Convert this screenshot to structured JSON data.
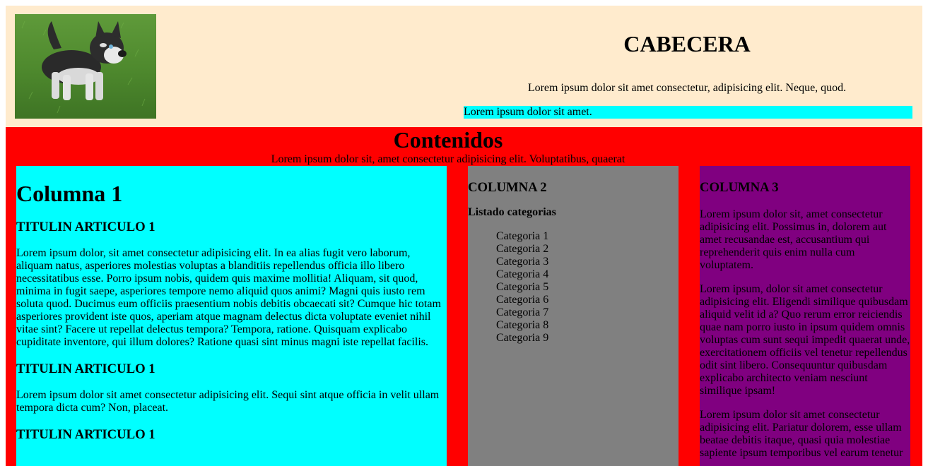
{
  "header": {
    "title": "CABECERA",
    "subtitle": "Lorem ipsum dolor sit amet consectetur, adipisicing elit. Neque, quod.",
    "bar_text": "Lorem ipsum dolor sit amet.",
    "image": "husky-puppy-photo",
    "colors": {
      "background": "#ffebcd",
      "bar": "#00ffff"
    }
  },
  "content": {
    "title": "Contenidos",
    "subtitle": "Lorem ipsum dolor sit, amet consectetur adipisicing elit. Voluptatibus, quaerat",
    "colors": {
      "background": "#ff0000"
    },
    "col1": {
      "color": "#00ffff",
      "heading": "Columna 1",
      "articles": [
        {
          "title": "TITULIN ARTICULO 1",
          "text": "Lorem ipsum dolor, sit amet consectetur adipisicing elit. In ea alias fugit vero laborum, aliquam natus, asperiores molestias voluptas a blanditiis repellendus officia illo libero necessitatibus esse. Porro ipsum nobis, quidem quis maxime mollitia! Aliquam, sit quod, minima in fugit saepe, asperiores tempore nemo aliquid quos animi? Magni quis iusto rem soluta quod. Ducimus eum officiis praesentium nobis debitis obcaecati sit? Cumque hic totam asperiores provident iste quos, aperiam atque magnam delectus dicta voluptate eveniet nihil vitae sint? Facere ut repellat delectus tempora? Tempora, ratione. Quisquam explicabo cupiditate inventore, qui illum dolores? Ratione quasi sint minus magni iste repellat facilis."
        },
        {
          "title": "TITULIN ARTICULO 1",
          "text": "Lorem ipsum dolor sit amet consectetur adipisicing elit. Sequi sint atque officia in velit ullam tempora dicta cum? Non, placeat."
        },
        {
          "title": "TITULIN ARTICULO 1"
        }
      ]
    },
    "col2": {
      "color": "#808080",
      "heading": "COLUMNA 2",
      "subheading": "Listado categorias",
      "items": [
        "Categoria 1",
        "Categoria 2",
        "Categoria 3",
        "Categoria 4",
        "Categoria 5",
        "Categoria 6",
        "Categoria 7",
        "Categoria 8",
        "Categoria 9"
      ]
    },
    "col3": {
      "color": "#800080",
      "heading": "COLUMNA 3",
      "paragraphs": [
        "Lorem ipsum dolor sit, amet consectetur adipisicing elit. Possimus in, dolorem aut amet recusandae est, accusantium qui reprehenderit quis enim nulla cum voluptatem.",
        "Lorem ipsum, dolor sit amet consectetur adipisicing elit. Eligendi similique quibusdam aliquid velit id a? Quo rerum error reiciendis quae nam porro iusto in ipsum quidem omnis voluptas cum sunt sequi impedit quaerat unde, exercitationem officiis vel tenetur repellendus odit sint libero. Consequuntur quibusdam explicabo architecto veniam nesciunt similique ipsam!",
        "Lorem ipsum dolor sit amet consectetur adipisicing elit. Pariatur dolorem, esse ullam beatae debitis itaque, quasi quia molestiae sapiente ipsum temporibus vel earum tenetur"
      ]
    }
  }
}
